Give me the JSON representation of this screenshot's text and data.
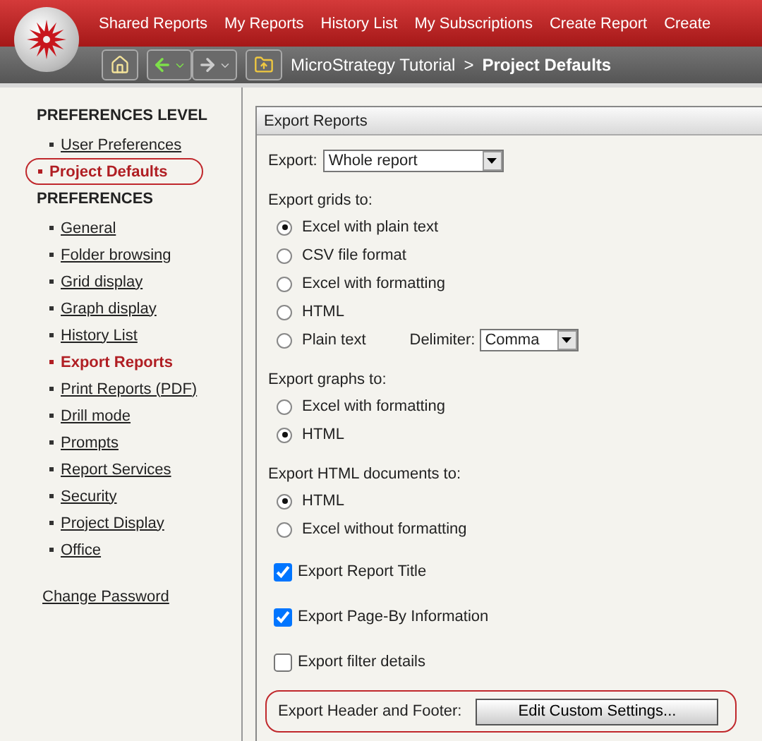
{
  "top_nav": {
    "tabs": [
      {
        "label": "Shared Reports"
      },
      {
        "label": "My Reports"
      },
      {
        "label": "History List"
      },
      {
        "label": "My Subscriptions"
      },
      {
        "label": "Create Report"
      },
      {
        "label": "Create"
      }
    ]
  },
  "toolbar": {
    "breadcrumb": [
      {
        "label": "MicroStrategy Tutorial",
        "current": false
      },
      {
        "label": "Project Defaults",
        "current": true
      }
    ],
    "separator": ">"
  },
  "sidebar": {
    "sections": [
      {
        "heading": "PREFERENCES LEVEL",
        "items": [
          {
            "label": "User Preferences",
            "selected": false,
            "highlighted": false
          },
          {
            "label": "Project Defaults",
            "selected": true,
            "highlighted": true
          }
        ]
      },
      {
        "heading": "PREFERENCES",
        "items": [
          {
            "label": "General",
            "selected": false,
            "highlighted": false
          },
          {
            "label": "Folder browsing",
            "selected": false,
            "highlighted": false
          },
          {
            "label": "Grid display",
            "selected": false,
            "highlighted": false
          },
          {
            "label": "Graph display",
            "selected": false,
            "highlighted": false
          },
          {
            "label": "History List",
            "selected": false,
            "highlighted": false
          },
          {
            "label": "Export Reports",
            "selected": true,
            "highlighted": false
          },
          {
            "label": "Print Reports (PDF)",
            "selected": false,
            "highlighted": false
          },
          {
            "label": "Drill mode",
            "selected": false,
            "highlighted": false
          },
          {
            "label": "Prompts",
            "selected": false,
            "highlighted": false
          },
          {
            "label": "Report Services",
            "selected": false,
            "highlighted": false
          },
          {
            "label": "Security",
            "selected": false,
            "highlighted": false
          },
          {
            "label": "Project Display",
            "selected": false,
            "highlighted": false
          },
          {
            "label": "Office",
            "selected": false,
            "highlighted": false
          }
        ]
      }
    ],
    "link": "Change Password"
  },
  "panel": {
    "title": "Export Reports",
    "export": {
      "label": "Export:",
      "value": "Whole report"
    },
    "groups": [
      {
        "label": "Export grids to:",
        "options": [
          {
            "label": "Excel with plain text",
            "selected": true
          },
          {
            "label": "CSV file format",
            "selected": false
          },
          {
            "label": "Excel with formatting",
            "selected": false
          },
          {
            "label": "HTML",
            "selected": false
          },
          {
            "label": "Plain text",
            "selected": false,
            "delimiter": {
              "label": "Delimiter:",
              "value": "Comma"
            }
          }
        ]
      },
      {
        "label": "Export graphs to:",
        "options": [
          {
            "label": "Excel with formatting",
            "selected": false
          },
          {
            "label": "HTML",
            "selected": true
          }
        ]
      },
      {
        "label": "Export HTML documents to:",
        "options": [
          {
            "label": "HTML",
            "selected": true
          },
          {
            "label": "Excel without formatting",
            "selected": false
          }
        ]
      }
    ],
    "checkboxes": [
      {
        "label": "Export Report Title",
        "checked": true
      },
      {
        "label": "Export Page-By Information",
        "checked": true
      },
      {
        "label": "Export filter details",
        "checked": false
      }
    ],
    "header_footer": {
      "label": "Export Header and Footer:",
      "button": "Edit Custom Settings...",
      "highlighted": true
    }
  }
}
